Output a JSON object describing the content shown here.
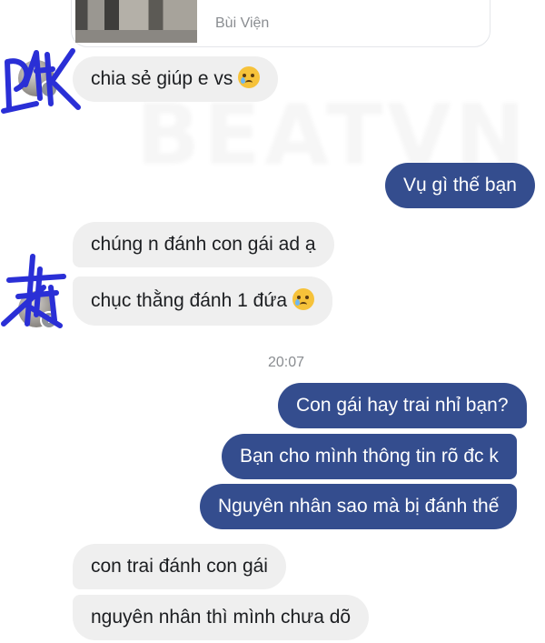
{
  "link_preview": {
    "subtitle": "Bùi Viện"
  },
  "watermark": "BEATVN",
  "messages": [
    {
      "side": "in",
      "text": "chia sẻ giúp e vs",
      "emoji": "crying-face"
    },
    {
      "side": "out",
      "text": "Vụ gì thế bạn"
    },
    {
      "side": "in",
      "text": "chúng n đánh con gái ad ạ"
    },
    {
      "side": "in",
      "text": "chục thằng đánh 1 đứa",
      "emoji": "crying-face"
    },
    {
      "side": "out",
      "text": "Con gái hay trai nhỉ bạn?"
    },
    {
      "side": "out",
      "text": "Bạn cho mình thông tin rõ đc k"
    },
    {
      "side": "out",
      "text": "Nguyên nhân sao mà bị đánh thế"
    },
    {
      "side": "in",
      "text": "con trai đánh con gái"
    },
    {
      "side": "in",
      "text": "nguyên nhân thì mình chưa dõ"
    }
  ],
  "timestamp": "20:07",
  "colors": {
    "outgoing_bubble": "#344d8e",
    "incoming_bubble": "#efefef",
    "scribble": "#2a2fd6"
  },
  "icons": {
    "avatar_badge": "facebook-icon",
    "emoji": "crying-face-icon"
  }
}
